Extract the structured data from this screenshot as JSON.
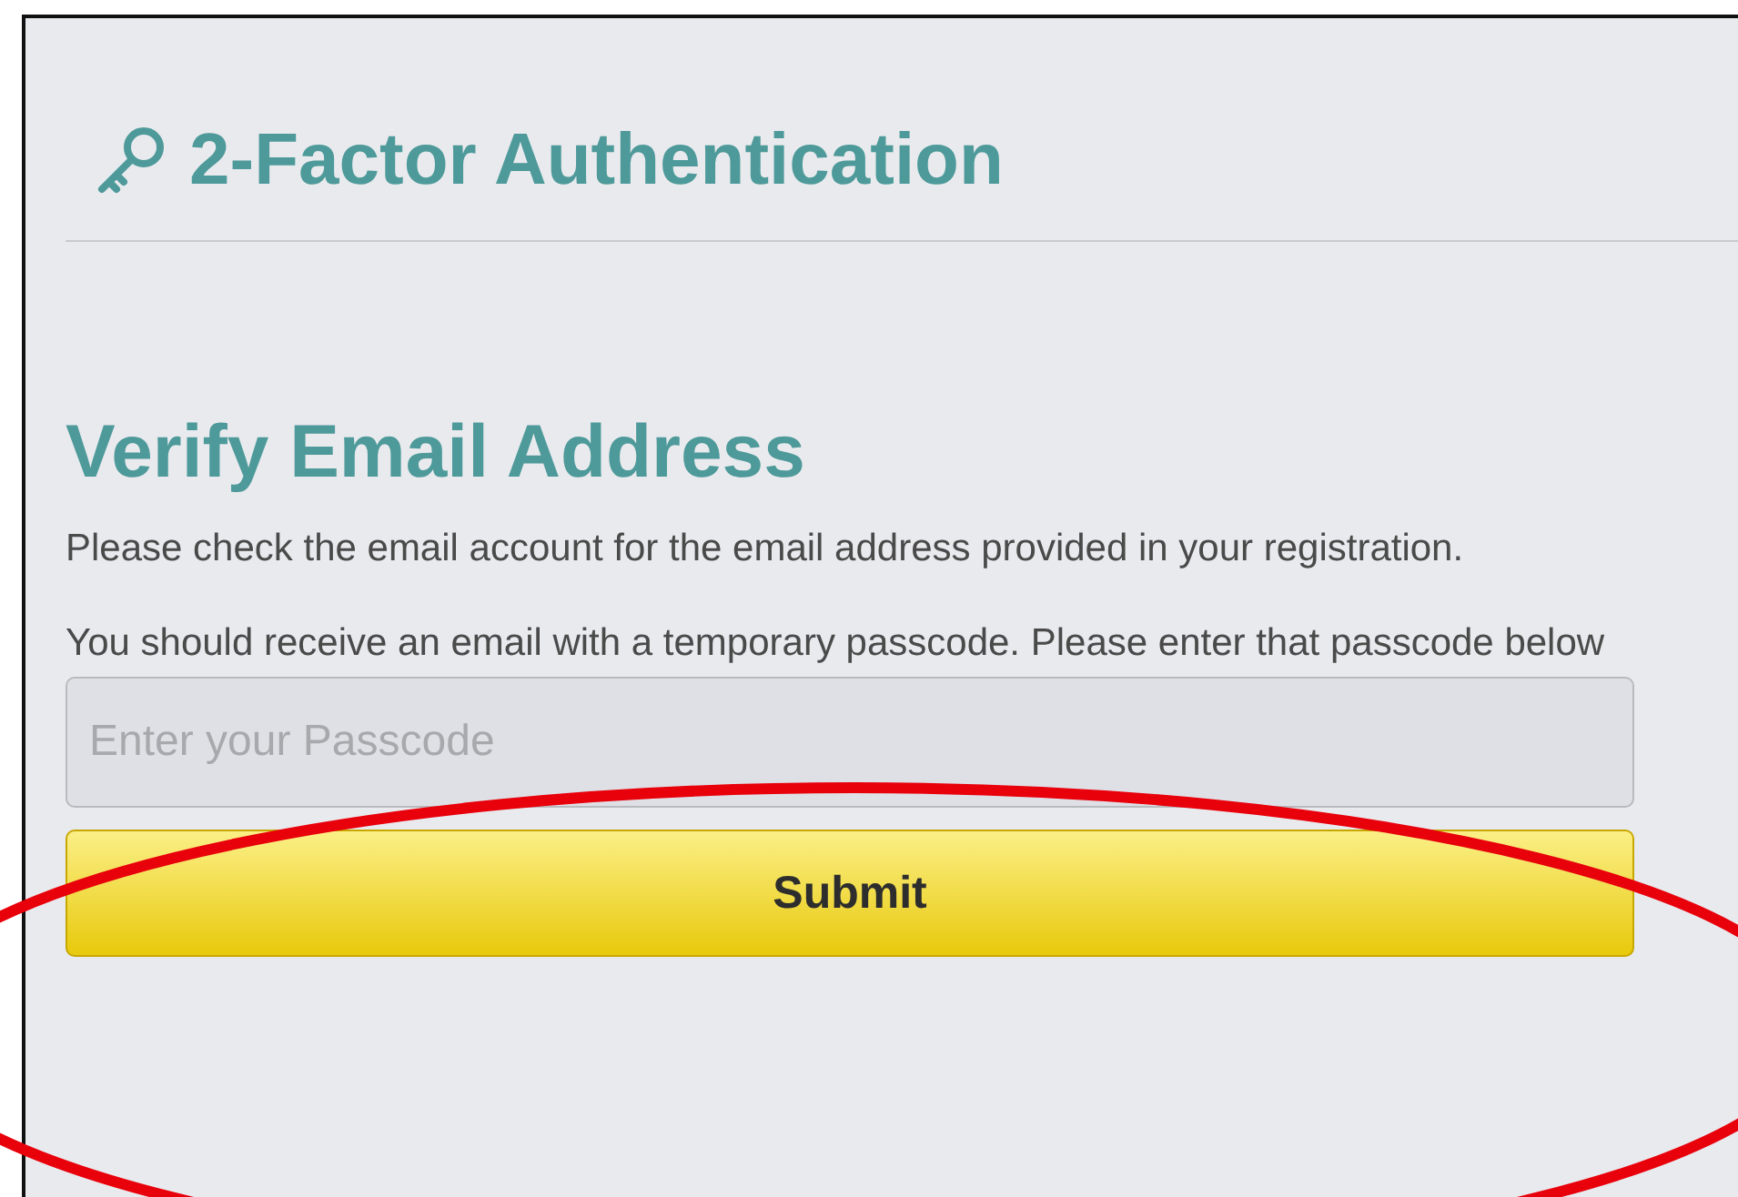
{
  "header": {
    "title": "2-Factor Authentication"
  },
  "section": {
    "heading": "Verify Email Address",
    "paragraphs": [
      "Please check the email account for the email address provided in your registration.",
      "You should receive an email with a temporary passcode. Please enter that passcode below"
    ]
  },
  "passcode_field": {
    "placeholder": "Enter your Passcode"
  },
  "buttons": [
    {
      "label": "Submit",
      "kind": "primary"
    }
  ]
}
